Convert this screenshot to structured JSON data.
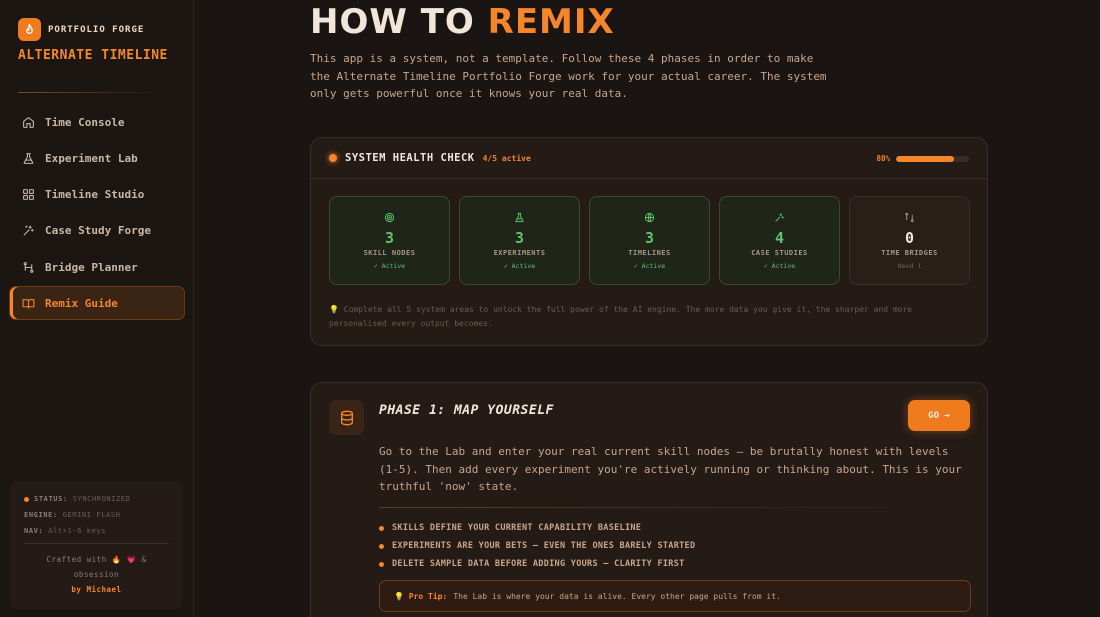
{
  "brand": {
    "small": "PORTFOLIO FORGE",
    "title": "ALTERNATE TIMELINE"
  },
  "nav": [
    {
      "label": "Time Console",
      "icon": "home-icon"
    },
    {
      "label": "Experiment Lab",
      "icon": "flask-icon"
    },
    {
      "label": "Timeline Studio",
      "icon": "grid-icon"
    },
    {
      "label": "Case Study Forge",
      "icon": "sparkle-icon"
    },
    {
      "label": "Bridge Planner",
      "icon": "route-icon"
    },
    {
      "label": "Remix Guide",
      "icon": "book-icon",
      "active": true
    }
  ],
  "status": {
    "status_key": "STATUS:",
    "status_val": "SYNCHRONIZED",
    "engine_key": "ENGINE:",
    "engine_val": "GEMINI FLASH",
    "nav_key": "NAV:",
    "nav_val": "Alt+1-6 keys",
    "crafted": "Crafted with 🔥 💗 & obsession",
    "by": "by Michael"
  },
  "header": {
    "title_a": "HOW TO",
    "title_b": "REMIX",
    "intro": "This app is a system, not a template. Follow these 4 phases in order to make the Alternate Timeline Portfolio Forge work for your actual career. The system only gets powerful once it knows your real data."
  },
  "health": {
    "title": "SYSTEM HEALTH CHECK",
    "count": "4/5 active",
    "progress_label": "80%",
    "progress": 0.8,
    "cards": [
      {
        "value": "3",
        "label": "SKILL NODES",
        "status": "✓ Active",
        "icon": "target-icon",
        "active": true
      },
      {
        "value": "3",
        "label": "EXPERIMENTS",
        "status": "✓ Active",
        "icon": "flask-icon",
        "active": true
      },
      {
        "value": "3",
        "label": "TIMELINES",
        "status": "✓ Active",
        "icon": "globe-icon",
        "active": true
      },
      {
        "value": "4",
        "label": "CASE STUDIES",
        "status": "✓ Active",
        "icon": "sparkle-icon",
        "active": true
      },
      {
        "value": "0",
        "label": "TIME BRIDGES",
        "status": "Need 1",
        "icon": "route-icon",
        "active": false
      }
    ],
    "note": "💡 Complete all 5 system areas to unlock the full power of the AI engine. The more data you give it, the sharper and more personalised every output becomes."
  },
  "phase": {
    "title": "PHASE 1: MAP YOURSELF",
    "go": "GO →",
    "desc": "Go to the Lab and enter your real current skill nodes — be brutally honest with levels (1-5). Then add every experiment you're actively running or thinking about. This is your truthful 'now' state.",
    "bullets": [
      "SKILLS DEFINE YOUR CURRENT CAPABILITY BASELINE",
      "EXPERIMENTS ARE YOUR BETS — EVEN THE ONES BARELY STARTED",
      "DELETE SAMPLE DATA BEFORE ADDING YOURS — CLARITY FIRST"
    ],
    "tip_key": "💡 Pro Tip:",
    "tip": "The Lab is where your data is alive. Every other page pulls from it."
  },
  "colors": {
    "accent": "#f5862a",
    "active_green": "#5fc46a",
    "bg": "#1a1412"
  }
}
